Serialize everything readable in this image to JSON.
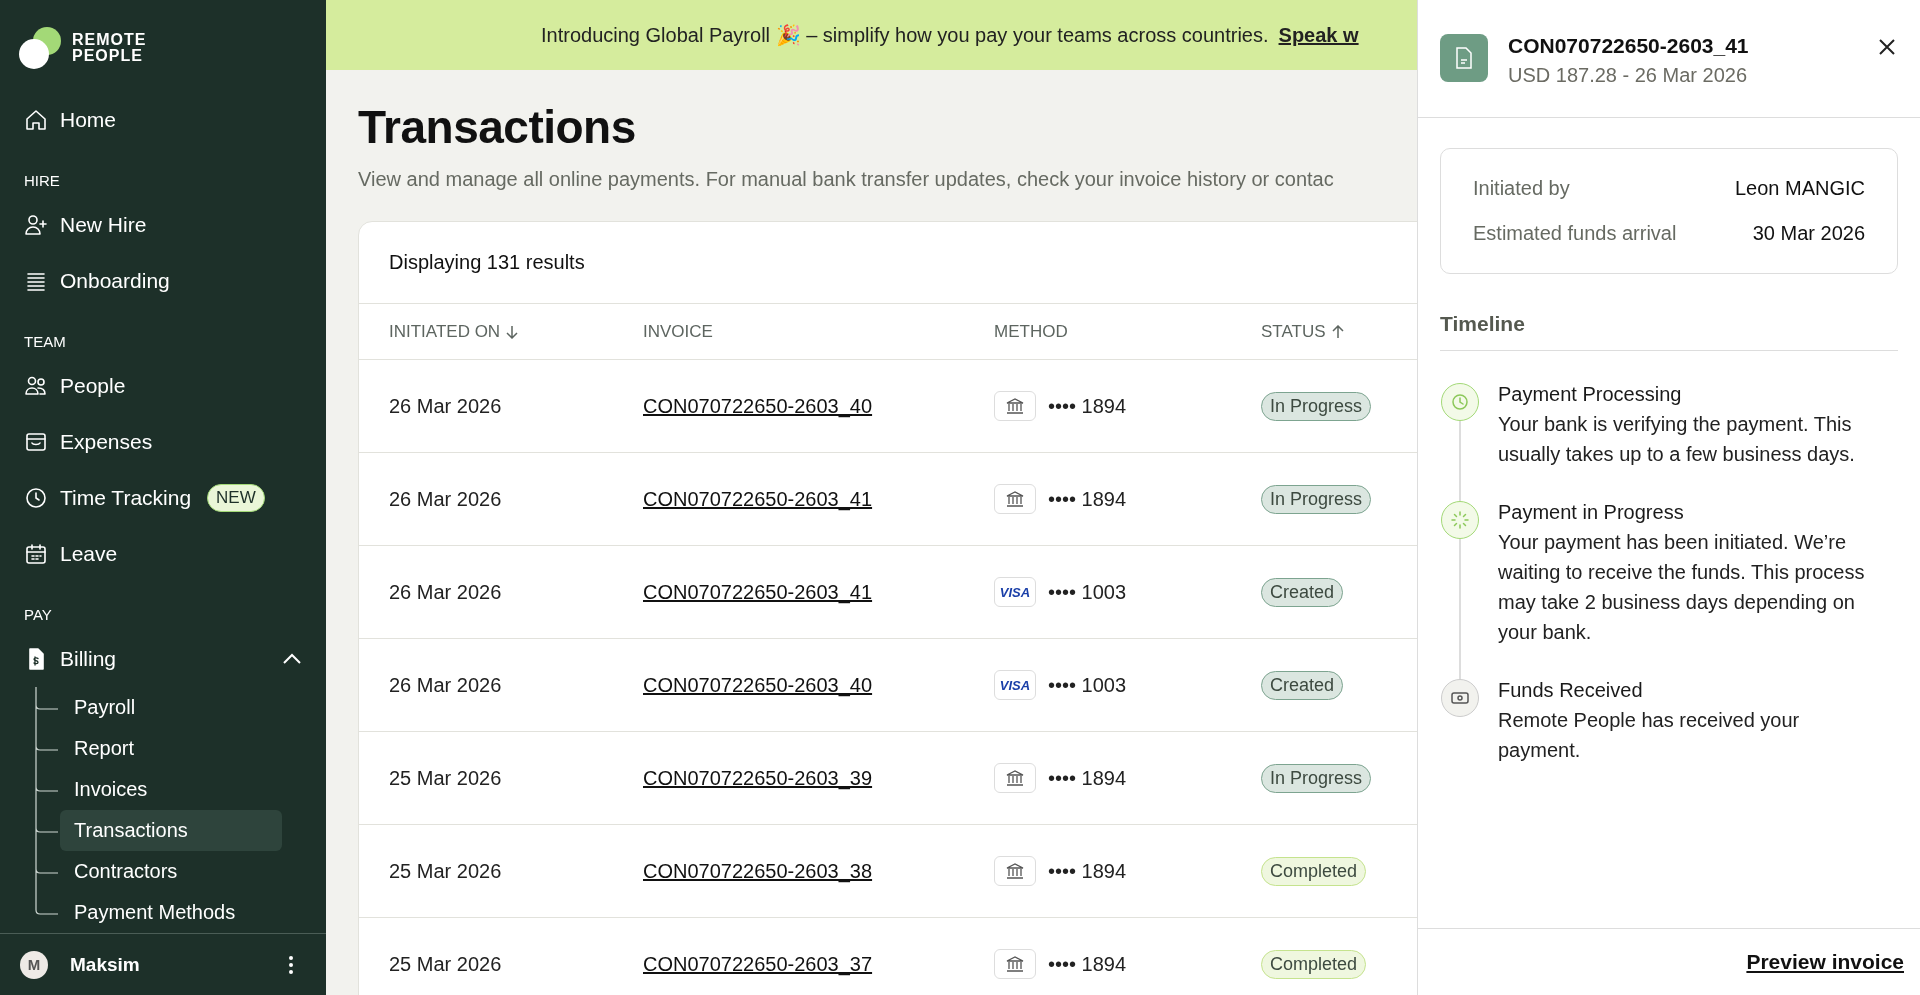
{
  "brand": {
    "line1": "REMOTE",
    "line2": "PEOPLE"
  },
  "sidebar": {
    "items": [
      {
        "kind": "home",
        "label": "Home",
        "selected": false
      },
      {
        "kind": "section",
        "label": "HIRE"
      },
      {
        "kind": "person-add",
        "label": "New Hire",
        "selected": false
      },
      {
        "kind": "list",
        "label": "Onboarding",
        "selected": false
      },
      {
        "kind": "section",
        "label": "TEAM"
      },
      {
        "kind": "people",
        "label": "People",
        "selected": false
      },
      {
        "kind": "tray",
        "label": "Expenses",
        "selected": false
      },
      {
        "kind": "clock",
        "label": "Time Tracking",
        "badge": "NEW",
        "selected": false
      },
      {
        "kind": "calendar",
        "label": "Leave",
        "selected": false
      },
      {
        "kind": "section",
        "label": "PAY"
      },
      {
        "kind": "document",
        "label": "Billing",
        "selected": false,
        "expanded": true,
        "children": [
          {
            "label": "Payroll",
            "selected": false
          },
          {
            "label": "Report",
            "selected": false
          },
          {
            "label": "Invoices",
            "selected": false
          },
          {
            "label": "Transactions",
            "selected": true
          },
          {
            "label": "Contractors",
            "selected": false
          },
          {
            "label": "Payment Methods",
            "selected": false
          }
        ]
      }
    ]
  },
  "user": {
    "initial": "M",
    "name": "Maksim"
  },
  "banner": {
    "text": "Introducing Global Payroll 🎉 – simplify how you pay your teams across countries.",
    "link": "Speak w"
  },
  "page": {
    "title": "Transactions",
    "subtitle": "View and manage all online payments. For manual bank transfer updates, check your invoice history or contac"
  },
  "table": {
    "count": "Displaying 131 results",
    "columns": [
      {
        "label": "INITIATED ON",
        "sorted": true,
        "ascending": false
      },
      {
        "label": "INVOICE",
        "sorted": false
      },
      {
        "label": "METHOD",
        "sorted": false
      },
      {
        "label": "STATUS",
        "sorted": true,
        "ascending": true
      }
    ],
    "rows": [
      {
        "date": "26 Mar 2026",
        "invoice": "CON070722650-2603_40",
        "kind": "bank",
        "masked": "•••• 1894",
        "status": "In Progress",
        "color": "#7da490"
      },
      {
        "date": "26 Mar 2026",
        "invoice": "CON070722650-2603_41",
        "kind": "bank",
        "masked": "•••• 1894",
        "status": "In Progress",
        "color": "#7da490"
      },
      {
        "date": "26 Mar 2026",
        "invoice": "CON070722650-2603_41",
        "kind": "card",
        "card_brand": "VISA",
        "masked": "•••• 1003",
        "status": "Created",
        "color": "#7da490"
      },
      {
        "date": "26 Mar 2026",
        "invoice": "CON070722650-2603_40",
        "kind": "card",
        "card_brand": "VISA",
        "masked": "•••• 1003",
        "status": "Created",
        "color": "#7da490"
      },
      {
        "date": "25 Mar 2026",
        "invoice": "CON070722650-2603_39",
        "kind": "bank",
        "masked": "•••• 1894",
        "status": "In Progress",
        "color": "#7da490"
      },
      {
        "date": "25 Mar 2026",
        "invoice": "CON070722650-2603_38",
        "kind": "bank",
        "masked": "•••• 1894",
        "status": "Completed",
        "color": "#c5e38e"
      },
      {
        "date": "25 Mar 2026",
        "invoice": "CON070722650-2603_37",
        "kind": "bank",
        "masked": "•••• 1894",
        "status": "Completed",
        "color": "#c5e38e"
      }
    ]
  },
  "panel": {
    "title": "CON070722650-2603_41",
    "subtitle": "USD 187.28 - 26 Mar 2026",
    "details": [
      {
        "label": "Initiated by",
        "value": "Leon MANGIC"
      },
      {
        "label": "Estimated funds arrival",
        "value": "30 Mar 2026"
      }
    ],
    "timeline_title": "Timeline",
    "timeline": [
      {
        "kind": "clock",
        "done": true,
        "title": "Payment Processing",
        "text": "Your bank is verifying the payment. This usually takes up to a few business days."
      },
      {
        "kind": "spinner",
        "done": true,
        "title": "Payment in Progress",
        "text": "Your payment has been initiated. We’re waiting to receive the funds. This process may take 2 business days depending on your bank."
      },
      {
        "kind": "money",
        "done": false,
        "title": "Funds Received",
        "text": "Remote People has received your payment."
      }
    ],
    "footer_link": "Preview invoice"
  }
}
